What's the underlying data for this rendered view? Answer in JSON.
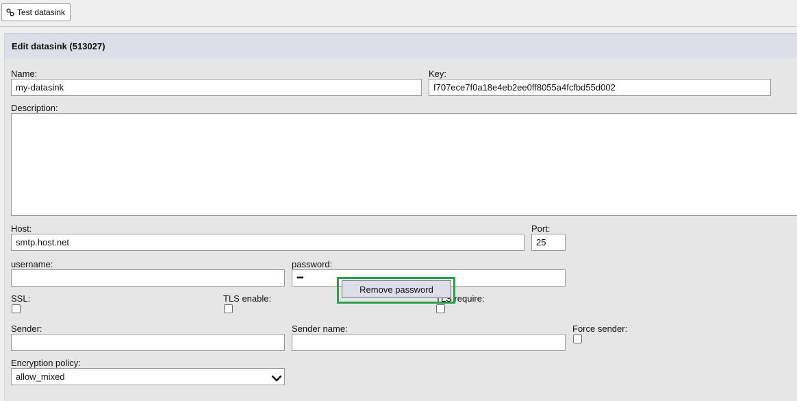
{
  "toolbar": {
    "test_button_label": "Test datasink",
    "test_button_icon": "link-icon"
  },
  "panel": {
    "title": "Edit datasink (513027)"
  },
  "form": {
    "name_label": "Name:",
    "name_value": "my-datasink",
    "key_label": "Key:",
    "key_value": "f707ece7f0a18e4eb2ee0ff8055a4fcfbd55d002",
    "description_label": "Description:",
    "description_value": "",
    "host_label": "Host:",
    "host_value": "smtp.host.net",
    "port_label": "Port:",
    "port_value": "25",
    "username_label": "username:",
    "username_value": "",
    "password_label": "password:",
    "password_value": "•••",
    "remove_password_label": "Remove password",
    "ssl_label": "SSL:",
    "ssl_checked": false,
    "tls_enable_label": "TLS enable:",
    "tls_enable_checked": false,
    "tls_require_label": "TLS require:",
    "tls_require_checked": false,
    "sender_label": "Sender:",
    "sender_value": "",
    "sender_name_label": "Sender name:",
    "sender_name_value": "",
    "force_sender_label": "Force sender:",
    "force_sender_checked": false,
    "encryption_policy_label": "Encryption policy:",
    "encryption_policy_value": "allow_mixed"
  },
  "colors": {
    "header_bg": "#dcdfe8",
    "highlight_border": "#2e9e4a",
    "page_bg": "#efefef"
  }
}
